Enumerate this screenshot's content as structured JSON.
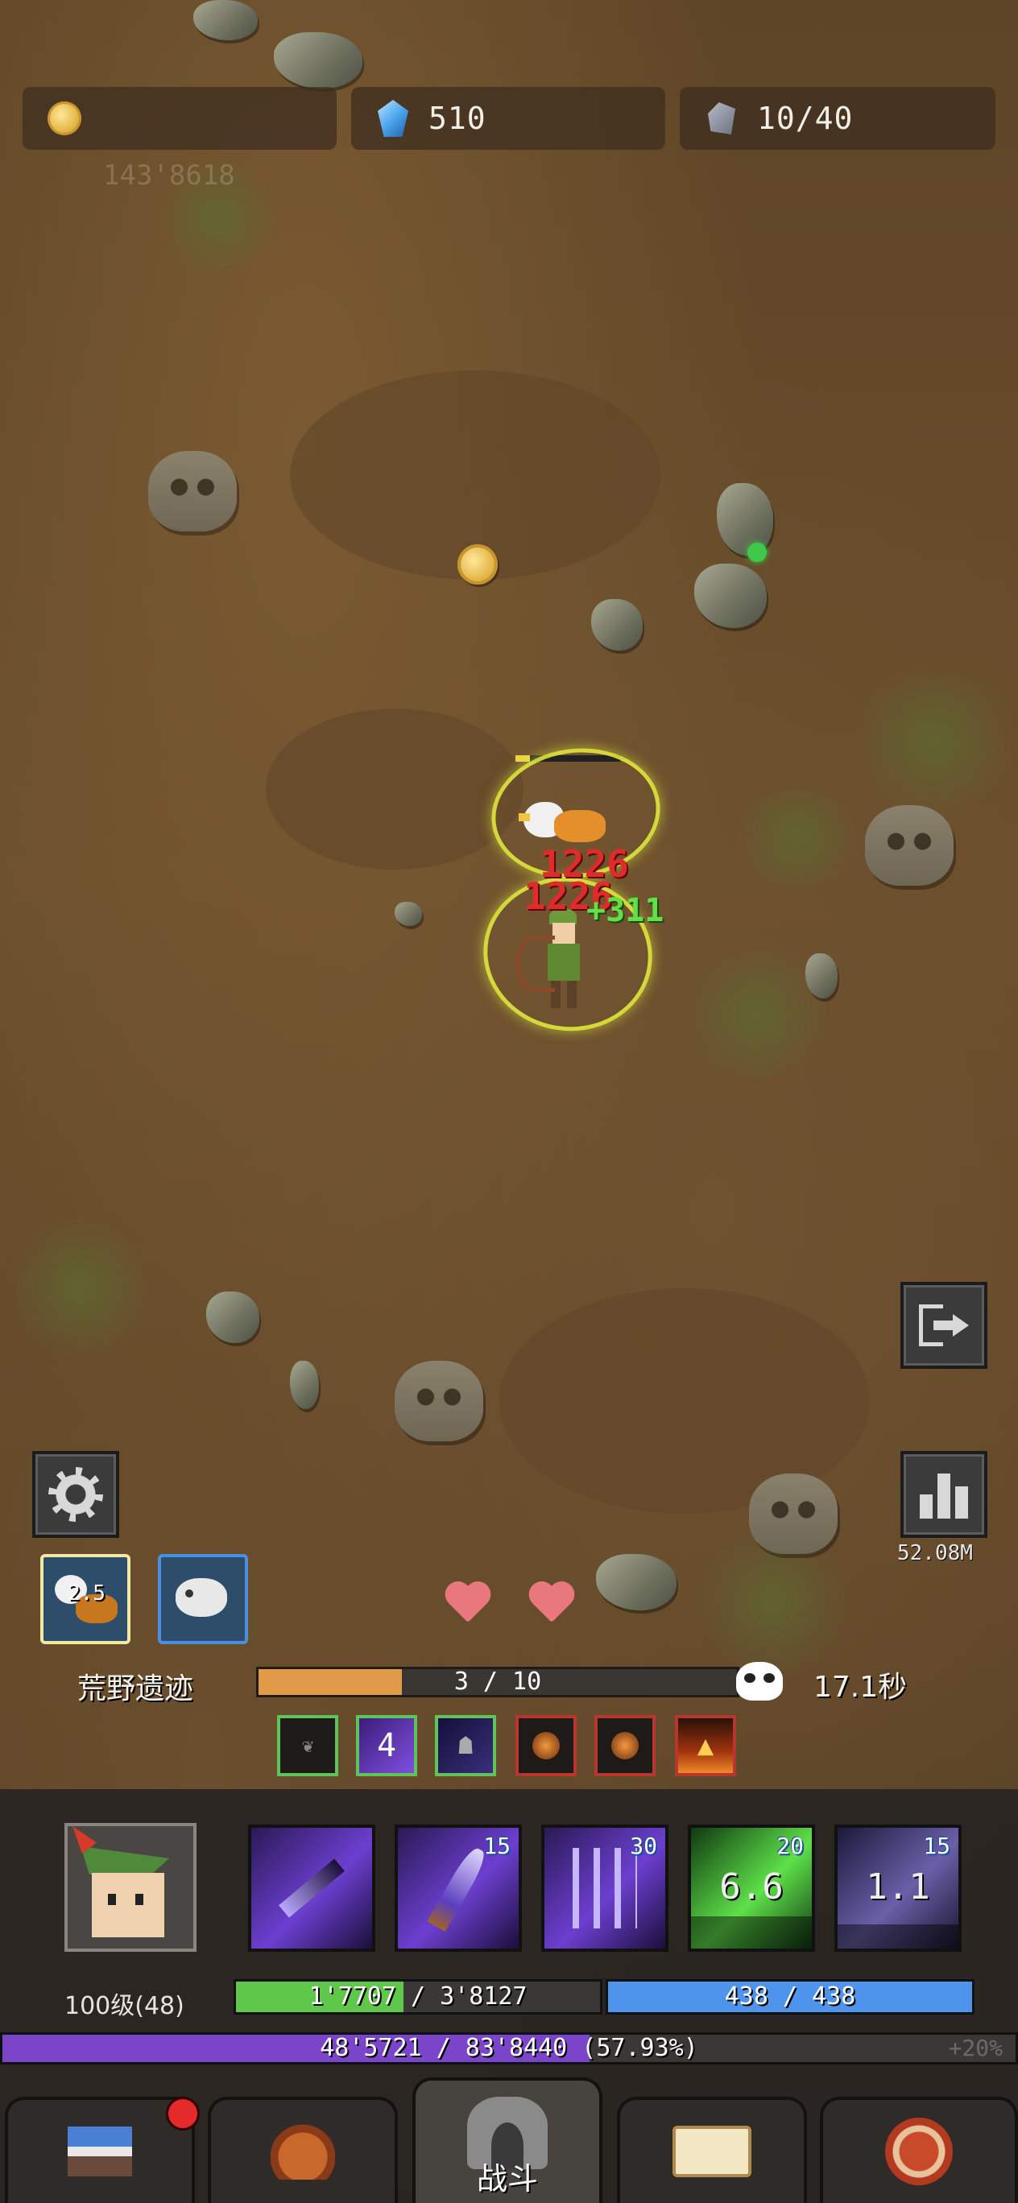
{
  "resources": {
    "gold": "",
    "gems": "510",
    "ore": "10/40"
  },
  "background_hint": "143'8618",
  "combat": {
    "damage_1": "1226",
    "damage_2": "1226",
    "heal": "+311"
  },
  "side": {
    "dps": "52.08M"
  },
  "pets": [
    {
      "name": "griffin-pet",
      "value": "2.5"
    },
    {
      "name": "boar-pet",
      "value": ""
    }
  ],
  "lives": 2,
  "stage": {
    "name": "荒野遗迹",
    "progress_text": "3 / 10",
    "progress": 0.3,
    "timer": "17.1秒"
  },
  "buffs": [
    {
      "name": "shadow-claw-buff",
      "label": "",
      "border": "green"
    },
    {
      "name": "void-buff",
      "label": "4",
      "border": "green"
    },
    {
      "name": "shade-buff",
      "label": "",
      "border": "green"
    },
    {
      "name": "fire-orb-buff",
      "label": "",
      "border": "red"
    },
    {
      "name": "fire-orb-buff-2",
      "label": "",
      "border": "red"
    },
    {
      "name": "flame-buff",
      "label": "",
      "border": "red"
    }
  ],
  "hero": {
    "level_text": "100级(48)",
    "hp_text": "1'7707 / 3'8127",
    "hp_ratio": 0.46,
    "mp_text": "438 / 438",
    "mp_ratio": 1.0,
    "xp_text": "48'5721 / 83'8440 (57.93%)",
    "xp_ratio": 0.5793,
    "xp_bonus": "+20%"
  },
  "skills": [
    {
      "name": "arrow-skill",
      "badge": "",
      "cooldown": ""
    },
    {
      "name": "blade-skill",
      "badge": "15",
      "cooldown": ""
    },
    {
      "name": "triple-arrow-skill",
      "badge": "30",
      "cooldown": ""
    },
    {
      "name": "poison-paw-skill",
      "badge": "20",
      "cooldown": "6.6"
    },
    {
      "name": "hooded-shade-skill",
      "badge": "15",
      "cooldown": "1.1"
    }
  ],
  "nav": {
    "battle_label": "战斗"
  },
  "colors": {
    "hp": "#5fc84a",
    "mp": "#4f94ec",
    "xp": "#7a45c9",
    "stage": "#e19a48"
  }
}
